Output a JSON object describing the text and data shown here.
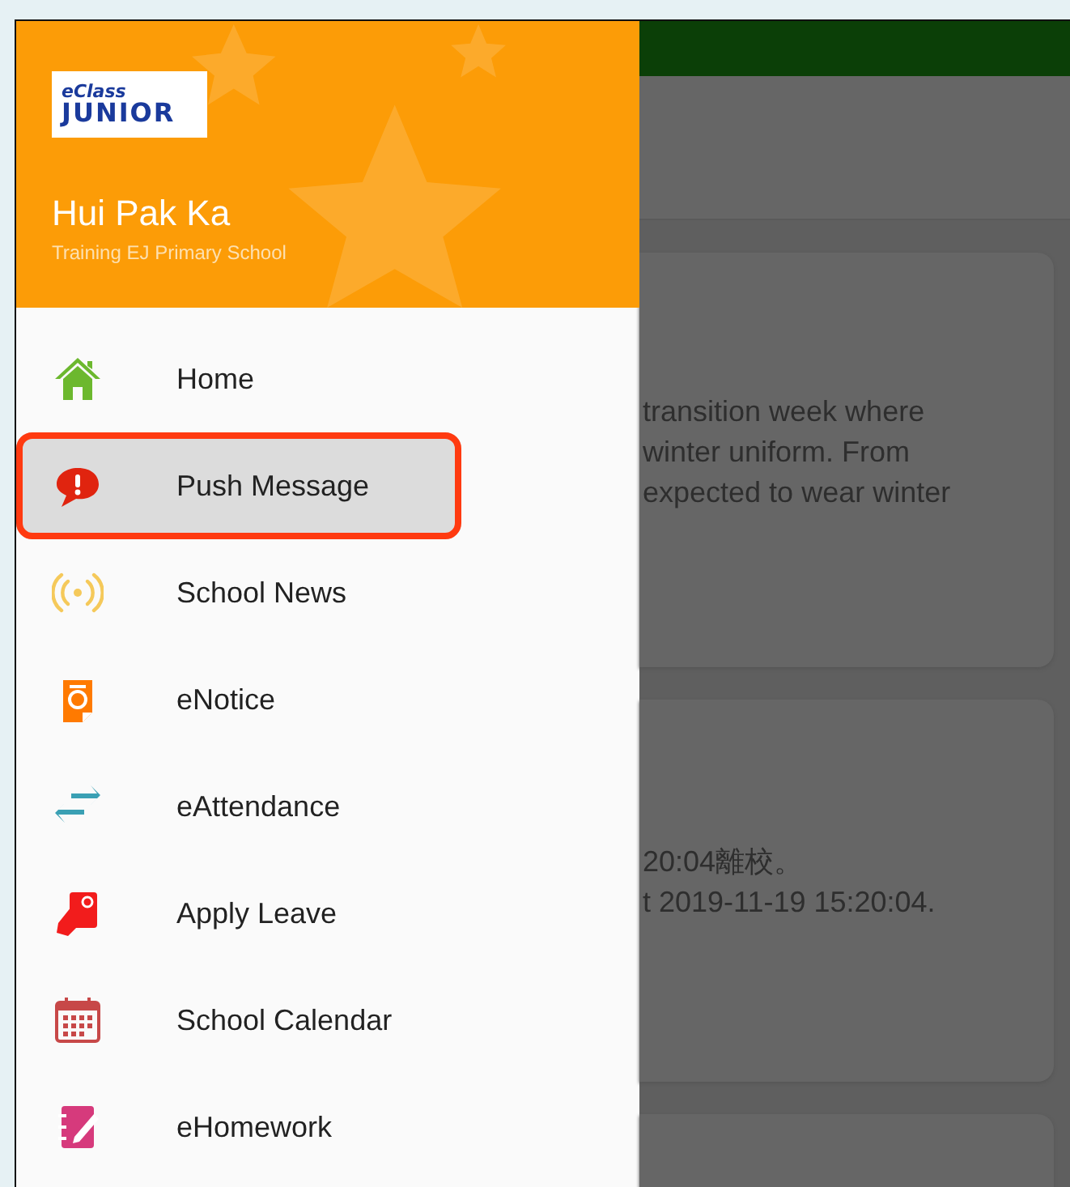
{
  "drawer": {
    "logo": {
      "top": "eClass",
      "bottom": "JUNIOR"
    },
    "user_name": "Hui Pak Ka",
    "school": "Training EJ Primary School",
    "items": [
      {
        "label": "Home",
        "kind": "home",
        "selected": false,
        "annotated": false
      },
      {
        "label": "Push Message",
        "kind": "alert",
        "selected": true,
        "annotated": true
      },
      {
        "label": "School News",
        "kind": "broadcast",
        "selected": false,
        "annotated": false
      },
      {
        "label": "eNotice",
        "kind": "notice",
        "selected": false,
        "annotated": false
      },
      {
        "label": "eAttendance",
        "kind": "arrows",
        "selected": false,
        "annotated": false
      },
      {
        "label": "Apply Leave",
        "kind": "leave",
        "selected": false,
        "annotated": false
      },
      {
        "label": "School Calendar",
        "kind": "calendar",
        "selected": false,
        "annotated": false
      },
      {
        "label": "eHomework",
        "kind": "homework",
        "selected": false,
        "annotated": false
      }
    ]
  },
  "cards": [
    {
      "lines": [
        "transition week where",
        "winter uniform. From",
        "expected to wear winter"
      ]
    },
    {
      "lines": [
        "20:04離校。",
        "t 2019-11-19 15:20:04."
      ]
    }
  ]
}
